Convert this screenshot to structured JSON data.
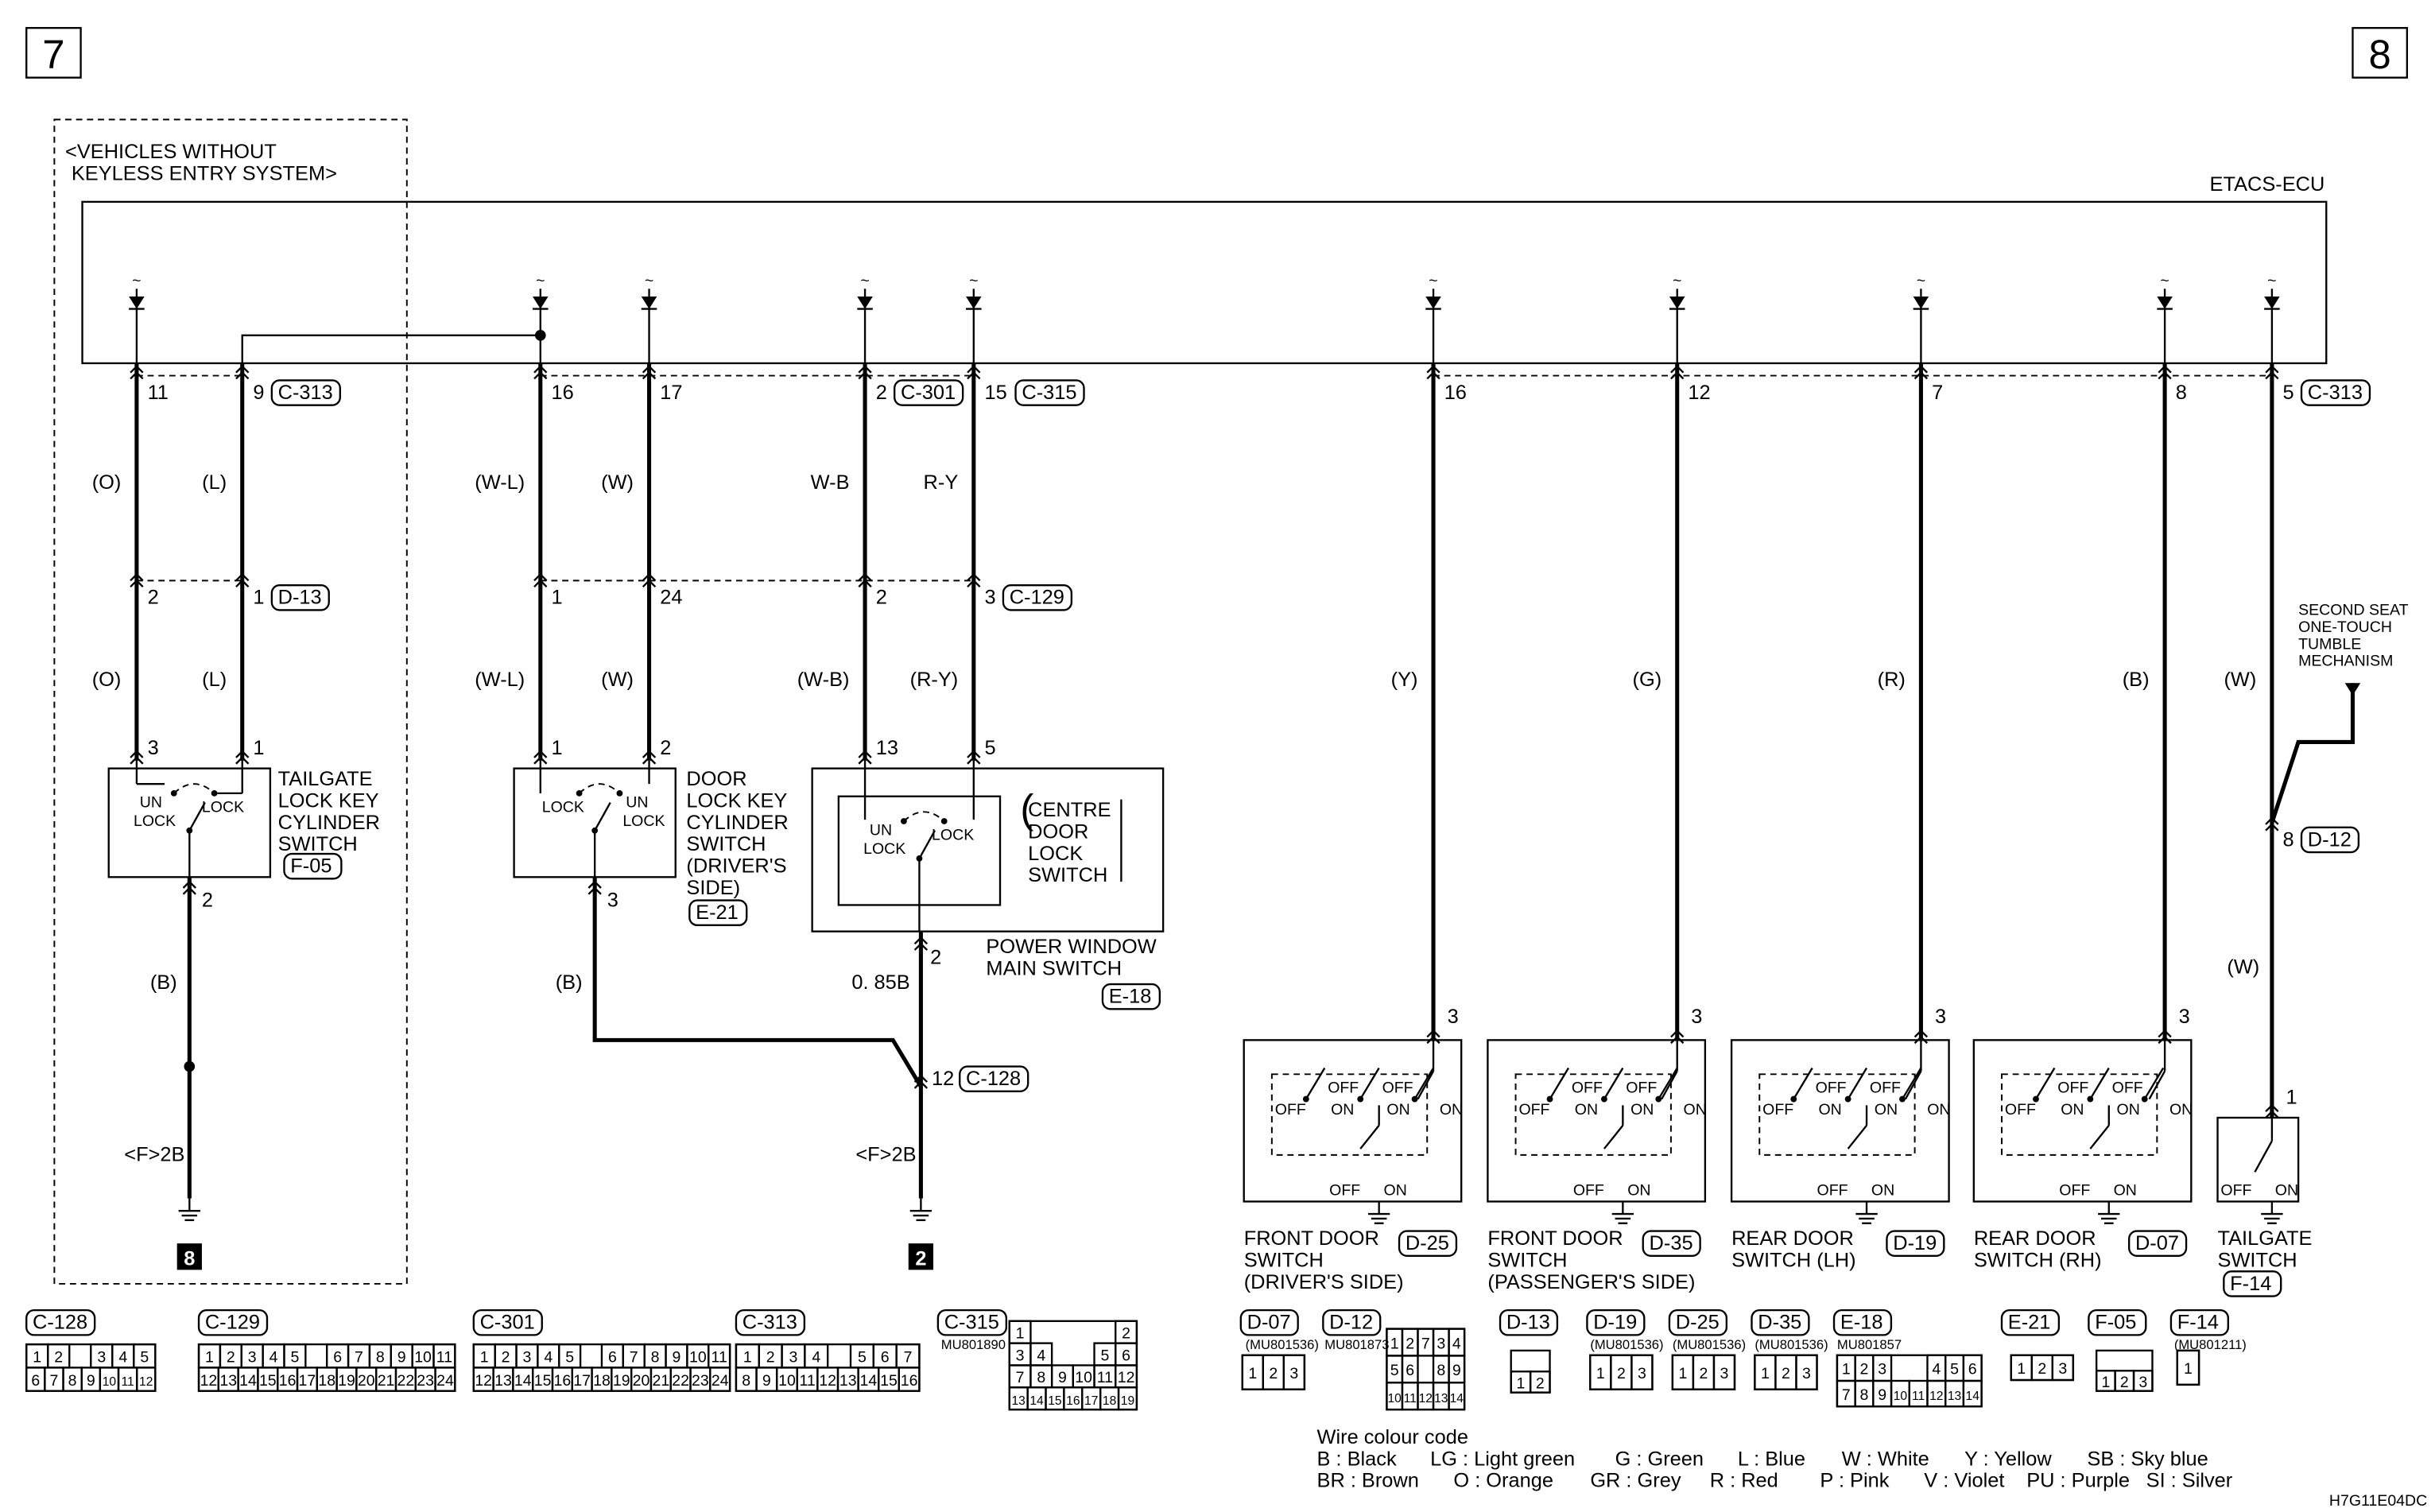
{
  "page_markers": {
    "left": "7",
    "right": "8"
  },
  "ecu": {
    "label": "ETACS-ECU"
  },
  "variant_note": {
    "line1": "<VEHICLES WITHOUT",
    "line2": "KEYLESS ENTRY SYSTEM>"
  },
  "ecu_pins": [
    {
      "pin": "11"
    },
    {
      "pin": "9",
      "connector": "C-313"
    },
    {
      "pin": "16"
    },
    {
      "pin": "17"
    },
    {
      "pin": "2",
      "connector": "C-301"
    },
    {
      "pin": "15",
      "connector": "C-315"
    },
    {
      "pin": "16"
    },
    {
      "pin": "12"
    },
    {
      "pin": "7"
    },
    {
      "pin": "8"
    },
    {
      "pin": "5",
      "connector": "C-313"
    }
  ],
  "wire_colors_upper": [
    "(O)",
    "(L)",
    "(W-L)",
    "(W)",
    "W-B",
    "R-Y"
  ],
  "intermediate_pins": [
    {
      "pin": "2"
    },
    {
      "pin": "1",
      "connector": "D-13"
    },
    {
      "pin": "1"
    },
    {
      "pin": "24"
    },
    {
      "pin": "2"
    },
    {
      "pin": "3",
      "connector": "C-129"
    }
  ],
  "wire_colors_lower": [
    "(O)",
    "(L)",
    "(W-L)",
    "(W)",
    "(W-B)",
    "(R-Y)",
    "(Y)",
    "(G)",
    "(R)",
    "(B)",
    "(W)"
  ],
  "component_pins": [
    "3",
    "1",
    "1",
    "2",
    "13",
    "5"
  ],
  "switch_states": {
    "off": "OFF",
    "on": "ON",
    "un": "UN",
    "lock": "LOCK"
  },
  "tailgate_lock_switch": {
    "lines": [
      "TAILGATE",
      "LOCK KEY",
      "CYLINDER",
      "SWITCH"
    ],
    "connector": "F-05",
    "out_pin": "2",
    "out_wire": "(B)",
    "ground_ref": "<F>2B",
    "ground_id": "8"
  },
  "door_lock_switch": {
    "lines": [
      "DOOR",
      "LOCK KEY",
      "CYLINDER",
      "SWITCH",
      "(DRIVER'S",
      "SIDE)"
    ],
    "connector": "E-21",
    "out_pin": "3",
    "out_wire": "(B)"
  },
  "power_window_switch": {
    "inner_lines": [
      "CENTRE",
      "DOOR",
      "LOCK",
      "SWITCH"
    ],
    "lines": [
      "POWER WINDOW",
      "MAIN SWITCH"
    ],
    "connector": "E-18",
    "out_pin": "2",
    "out_wire": "0. 85B",
    "joint_pin": "12",
    "joint_connector": "C-128",
    "ground_ref": "<F>2B",
    "ground_id": "2"
  },
  "door_switches": [
    {
      "lines": [
        "FRONT DOOR",
        "SWITCH",
        "(DRIVER'S SIDE)"
      ],
      "connector": "D-25",
      "pin": "3"
    },
    {
      "lines": [
        "FRONT DOOR",
        "SWITCH",
        "(PASSENGER'S SIDE)"
      ],
      "connector": "D-35",
      "pin": "3"
    },
    {
      "lines": [
        "REAR DOOR",
        "SWITCH (LH)"
      ],
      "connector": "D-19",
      "pin": "3"
    },
    {
      "lines": [
        "REAR DOOR",
        "SWITCH (RH)"
      ],
      "connector": "D-07",
      "pin": "3"
    }
  ],
  "tailgate_switch": {
    "lines": [
      "TAILGATE",
      "SWITCH"
    ],
    "connector": "F-14",
    "pin": "1",
    "wire": "(W)"
  },
  "second_seat": {
    "lines": [
      "SECOND SEAT",
      "ONE-TOUCH",
      "TUMBLE",
      "MECHANISM"
    ],
    "pin": "8",
    "connector": "D-12"
  },
  "connector_views": [
    {
      "id": "C-128",
      "rows": [
        [
          "1",
          "2",
          "",
          "3",
          "4",
          "5"
        ],
        [
          "6",
          "7",
          "8",
          "9",
          "10",
          "11",
          "12"
        ]
      ]
    },
    {
      "id": "C-129",
      "rows": [
        [
          "1",
          "2",
          "3",
          "4",
          "5",
          "",
          "6",
          "7",
          "8",
          "9",
          "10",
          "11"
        ],
        [
          "12",
          "13",
          "14",
          "15",
          "16",
          "17",
          "18",
          "19",
          "20",
          "21",
          "22",
          "23",
          "24"
        ]
      ]
    },
    {
      "id": "C-301",
      "rows": [
        [
          "1",
          "2",
          "3",
          "4",
          "5",
          "",
          "6",
          "7",
          "8",
          "9",
          "10",
          "11"
        ],
        [
          "12",
          "13",
          "14",
          "15",
          "16",
          "17",
          "18",
          "19",
          "20",
          "21",
          "22",
          "23",
          "24"
        ]
      ]
    },
    {
      "id": "C-313",
      "rows": [
        [
          "1",
          "2",
          "3",
          "4",
          "",
          "5",
          "6",
          "7"
        ],
        [
          "8",
          "9",
          "10",
          "11",
          "12",
          "13",
          "14",
          "15",
          "16"
        ]
      ]
    },
    {
      "id": "C-315",
      "part": "MU801890",
      "rows": [
        [
          "1",
          "",
          "",
          "",
          "",
          "2"
        ],
        [
          "3",
          "4",
          "",
          "",
          "5",
          "6"
        ],
        [
          "7",
          "8",
          "9",
          "10",
          "11",
          "12"
        ],
        [
          "13",
          "14",
          "15",
          "16",
          "17",
          "18",
          "19"
        ]
      ]
    },
    {
      "id": "D-07",
      "part": "(MU801536)",
      "rows": [
        [
          "1",
          "2",
          "3"
        ]
      ]
    },
    {
      "id": "D-12",
      "part": "MU801873",
      "rows": [
        [
          "1",
          "2",
          "7",
          "3",
          "4"
        ],
        [
          "5",
          "6",
          "",
          "8",
          "9"
        ],
        [
          "10",
          "11",
          "12",
          "13",
          "14"
        ]
      ]
    },
    {
      "id": "D-13",
      "rows": [
        [
          ""
        ],
        [
          "1",
          "2"
        ]
      ]
    },
    {
      "id": "D-19",
      "part": "(MU801536)",
      "rows": [
        [
          "1",
          "2",
          "3"
        ]
      ]
    },
    {
      "id": "D-25",
      "part": "(MU801536)",
      "rows": [
        [
          "1",
          "2",
          "3"
        ]
      ]
    },
    {
      "id": "D-35",
      "part": "(MU801536)",
      "rows": [
        [
          "1",
          "2",
          "3"
        ]
      ]
    },
    {
      "id": "E-18",
      "part": "MU801857",
      "rows": [
        [
          "1",
          "2",
          "3",
          "",
          "",
          "4",
          "5",
          "6"
        ],
        [
          "7",
          "8",
          "9",
          "10",
          "11",
          "12",
          "13",
          "14"
        ]
      ]
    },
    {
      "id": "E-21",
      "rows": [
        [
          "1",
          "2",
          "3"
        ]
      ]
    },
    {
      "id": "F-05",
      "rows": [
        [
          ""
        ],
        [
          "1",
          "2",
          "3"
        ]
      ]
    },
    {
      "id": "F-14",
      "part": "(MU801211)",
      "rows": [
        [
          "1"
        ]
      ]
    }
  ],
  "wire_colour_code": {
    "title": "Wire colour code",
    "row1": [
      "B : Black",
      "LG : Light green",
      "G : Green",
      "L : Blue",
      "W : White",
      "Y : Yellow",
      "SB : Sky blue"
    ],
    "row2": [
      "BR : Brown",
      "O : Orange",
      "GR : Grey",
      "R : Red",
      "P : Pink",
      "V : Violet",
      "PU : Purple",
      "SI : Silver"
    ]
  },
  "diagram_id": "H7G11E04DC"
}
